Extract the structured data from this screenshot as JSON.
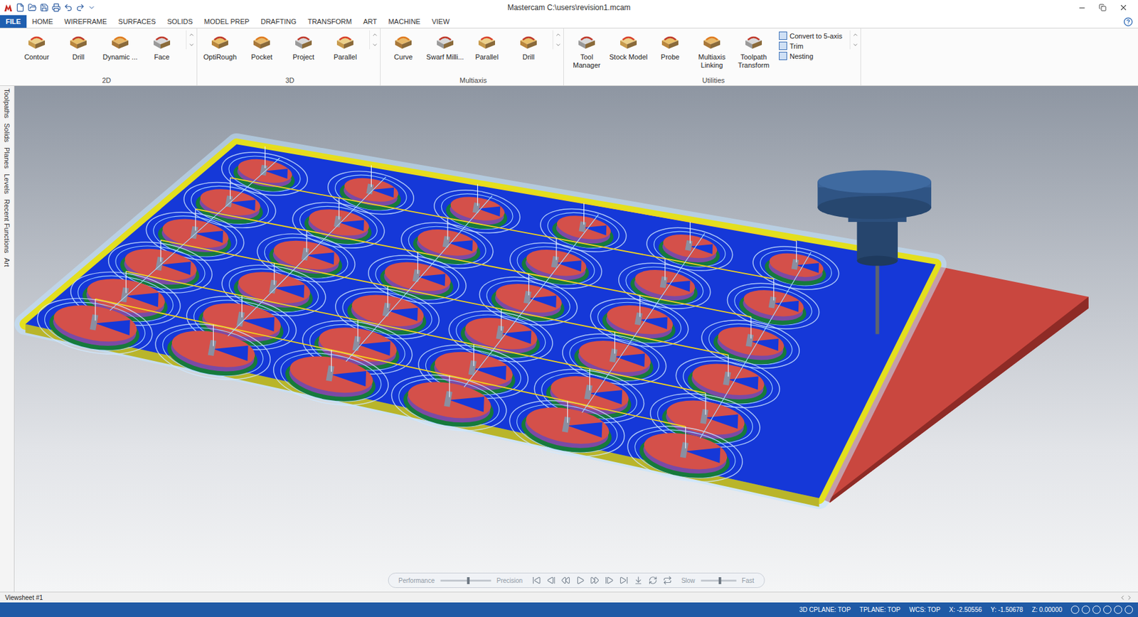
{
  "window": {
    "title": "Mastercam C:\\users\\revision1.mcam"
  },
  "menu_tabs": [
    {
      "label": "FILE",
      "selected": true
    },
    {
      "label": "HOME",
      "selected": false
    },
    {
      "label": "WIREFRAME",
      "selected": false
    },
    {
      "label": "SURFACES",
      "selected": false
    },
    {
      "label": "SOLIDS",
      "selected": false
    },
    {
      "label": "MODEL PREP",
      "selected": false
    },
    {
      "label": "DRAFTING",
      "selected": false
    },
    {
      "label": "TRANSFORM",
      "selected": false
    },
    {
      "label": "ART",
      "selected": false
    },
    {
      "label": "MACHINE",
      "selected": false
    },
    {
      "label": "VIEW",
      "selected": false
    }
  ],
  "ribbon": {
    "groups": [
      {
        "label": "2D",
        "buttons": [
          "Contour",
          "Drill",
          "Dynamic ...",
          "Face"
        ],
        "small_buttons": []
      },
      {
        "label": "3D",
        "buttons": [
          "OptiRough",
          "Pocket",
          "Project",
          "Parallel"
        ],
        "small_buttons": []
      },
      {
        "label": "Multiaxis",
        "buttons": [
          "Curve",
          "Swarf Milli...",
          "Parallel",
          "Drill"
        ],
        "small_buttons": []
      },
      {
        "label": "Utilities",
        "buttons": [
          "Tool Manager",
          "Stock Model",
          "Probe",
          "Multiaxis Linking",
          "Toolpath Transform"
        ],
        "small_buttons": [
          "Convert to 5-axis",
          "Trim",
          "Nesting"
        ]
      }
    ]
  },
  "side_tabs": [
    "Toolpaths",
    "Solids",
    "Planes",
    "Levels",
    "Recent Functions",
    "Art"
  ],
  "playback": {
    "left_slider": {
      "min_label": "Performance",
      "max_label": "Precision",
      "level": 0.55
    },
    "right_slider": {
      "min_label": "Slow",
      "max_label": "Fast",
      "level": 0.55
    }
  },
  "viewsheet_tab": "Viewsheet #1",
  "status_bar": {
    "items": [
      "3D CPLANE: TOP",
      "TPLANE: TOP",
      "WCS: TOP",
      "X: -2.50556",
      "Y: -1.50678",
      "Z: 0.00000"
    ]
  }
}
